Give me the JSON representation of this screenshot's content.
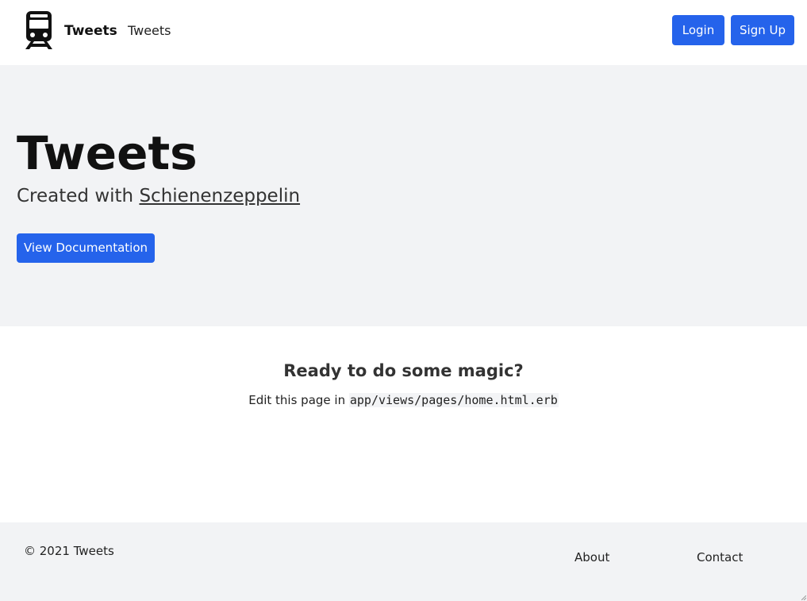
{
  "header": {
    "brand_name": "Tweets",
    "nav_link": "Tweets",
    "login_label": "Login",
    "signup_label": "Sign Up",
    "logo_icon": "train-icon",
    "accent_color": "#2563eb"
  },
  "hero": {
    "title": "Tweets",
    "subtitle_prefix": "Created with ",
    "subtitle_link": "Schienenzeppelin",
    "docs_button_label": "View Documentation"
  },
  "main": {
    "heading": "Ready to do some magic?",
    "text_prefix": "Edit this page in ",
    "code_path": "app/views/pages/home.html.erb"
  },
  "footer": {
    "copyright": "© 2021 Tweets",
    "about_label": "About",
    "contact_label": "Contact"
  }
}
